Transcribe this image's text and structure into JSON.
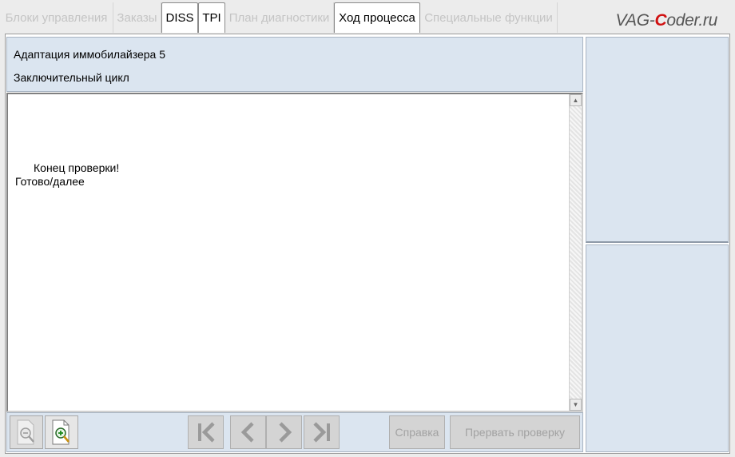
{
  "tabs": [
    {
      "label": "Блоки управления",
      "active": false
    },
    {
      "label": "Заказы",
      "active": false
    },
    {
      "label": "DISS",
      "active": true
    },
    {
      "label": "TPI",
      "active": true
    },
    {
      "label": "План диагностики",
      "active": false
    },
    {
      "label": "Ход процесса",
      "active": true
    },
    {
      "label": "Специальные функции",
      "active": false
    }
  ],
  "watermark": {
    "prefix": "VAG-",
    "accent": "C",
    "suffix": "oder.ru"
  },
  "info": {
    "title": "Адаптация иммобилайзера 5",
    "subtitle": "Заключительный цикл"
  },
  "content": {
    "line1": "Конец проверки!",
    "line2": "Готово/далее"
  },
  "toolbar": {
    "zoom_out_icon": "zoom-out-icon",
    "zoom_in_icon": "zoom-in-icon",
    "first_icon": "skip-first-icon",
    "prev_icon": "chevron-left-icon",
    "next_icon": "chevron-right-icon",
    "last_icon": "skip-last-icon",
    "help_label": "Справка",
    "abort_label": "Прервать проверку"
  },
  "colors": {
    "panel_bg": "#dbe5f0",
    "disabled_text": "#a2a2a2",
    "accent_red": "#d01010"
  }
}
